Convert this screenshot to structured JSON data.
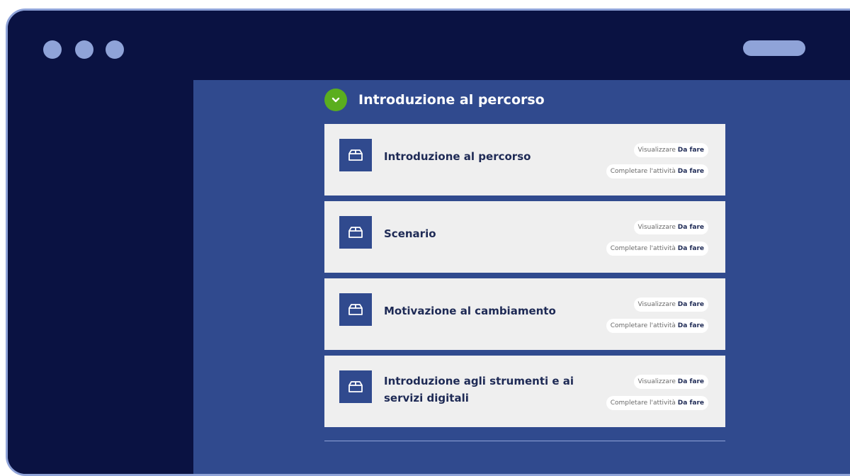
{
  "section": {
    "title": "Introduzione al percorso"
  },
  "labels": {
    "view": "Visualizzare",
    "complete": "Completare l'attività",
    "status": "Da fare"
  },
  "cards": [
    {
      "title": "Introduzione al percorso"
    },
    {
      "title": "Scenario"
    },
    {
      "title": "Motivazione al cambiamento"
    },
    {
      "title": "Introduzione agli strumenti e ai servizi digitali"
    }
  ],
  "colors": {
    "window": "#0a1242",
    "content": "#304a8e",
    "accent_green": "#5aae1e",
    "card": "#efefef",
    "frame": "#8fa3d8"
  },
  "icons": {
    "section_toggle": "chevron-down-icon",
    "activity": "box-icon"
  }
}
